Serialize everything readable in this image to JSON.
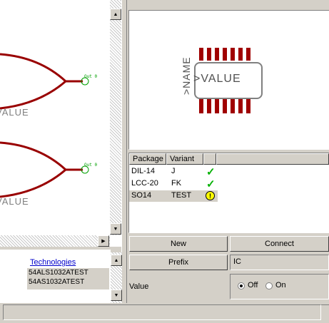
{
  "schematic": {
    "value_label_1": "VALUE",
    "value_label_2": "VALUE",
    "pin_label_1": "Out 0",
    "pin_label_2": "Out 0"
  },
  "preview": {
    "name_label": ">NAME",
    "value_label": ">VALUE"
  },
  "package_table": {
    "headers": [
      "Package",
      "Variant",
      "",
      ""
    ],
    "rows": [
      {
        "package": "DIL-14",
        "variant": "J",
        "status": "check"
      },
      {
        "package": "LCC-20",
        "variant": "FK",
        "status": "check"
      },
      {
        "package": "SO14",
        "variant": "TEST",
        "status": "warning"
      }
    ]
  },
  "technologies": {
    "header": "Technologies",
    "items": [
      "54ALS1032ATEST",
      "54AS1032ATEST"
    ]
  },
  "buttons": {
    "new_label": "New",
    "connect_label": "Connect",
    "prefix_label": "Prefix"
  },
  "prefix_value": "IC",
  "value_section": {
    "label": "Value",
    "off_label": "Off",
    "on_label": "On",
    "selected": "Off"
  },
  "colors": {
    "wire": "#990000",
    "pin_green": "#00a000",
    "check_green": "#00b000",
    "warning_yellow": "#ffff00"
  },
  "icons": [
    "check-icon",
    "warning-icon",
    "scroll-up-arrow-icon",
    "scroll-down-arrow-icon",
    "scroll-right-arrow-icon"
  ]
}
